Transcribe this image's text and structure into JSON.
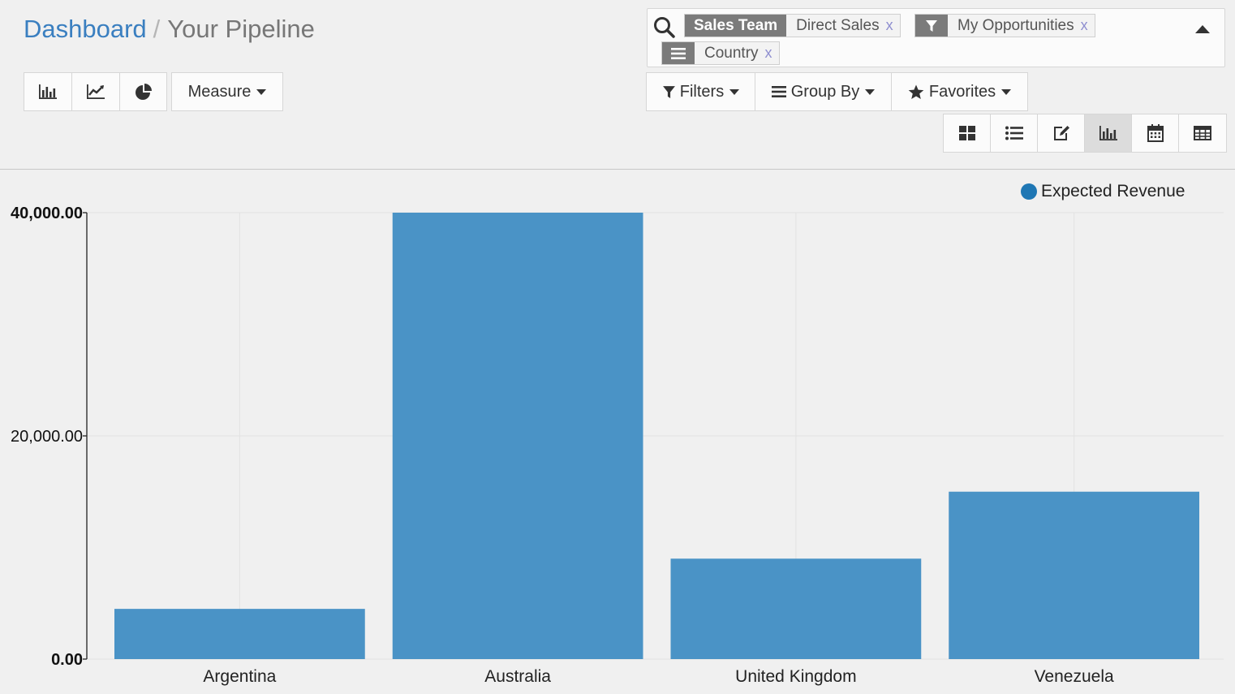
{
  "breadcrumb": {
    "parent": "Dashboard",
    "separator": "/",
    "current": "Your Pipeline"
  },
  "toolbar": {
    "chart_type_buttons": [
      {
        "name": "bar-chart-icon",
        "active": false
      },
      {
        "name": "line-chart-icon",
        "active": false
      },
      {
        "name": "pie-chart-icon",
        "active": false
      }
    ],
    "measure_label": "Measure"
  },
  "search": {
    "facets": [
      {
        "label": "Sales Team",
        "values": "Direct Sales",
        "remove": "x"
      },
      {
        "icon": "filter-icon",
        "values": "My Opportunities",
        "remove": "x"
      },
      {
        "icon": "list-icon",
        "values": "Country",
        "remove": "x"
      }
    ]
  },
  "search_options": {
    "filters_label": "Filters",
    "group_by_label": "Group By",
    "favorites_label": "Favorites"
  },
  "view_switcher": [
    {
      "name": "kanban-view-icon",
      "active": false
    },
    {
      "name": "list-view-icon",
      "active": false
    },
    {
      "name": "form-view-icon",
      "active": false
    },
    {
      "name": "graph-view-icon",
      "active": true
    },
    {
      "name": "calendar-view-icon",
      "active": false
    },
    {
      "name": "pivot-view-icon",
      "active": false
    }
  ],
  "colors": {
    "breadcrumb_link": "#3a7fc0",
    "bar_fill": "#4a93c6",
    "legend_dot": "#1f77b4",
    "facet_label_bg": "#7b7b7b"
  },
  "chart_data": {
    "type": "bar",
    "categories": [
      "Argentina",
      "Australia",
      "United Kingdom",
      "Venezuela"
    ],
    "series": [
      {
        "name": "Expected Revenue",
        "values": [
          4500,
          40000,
          9000,
          15000
        ]
      }
    ],
    "ylim": [
      0,
      40000
    ],
    "yticks": [
      "0.00",
      "20,000.00",
      "40,000.00"
    ],
    "legend_position": "top-right",
    "grid": true
  }
}
